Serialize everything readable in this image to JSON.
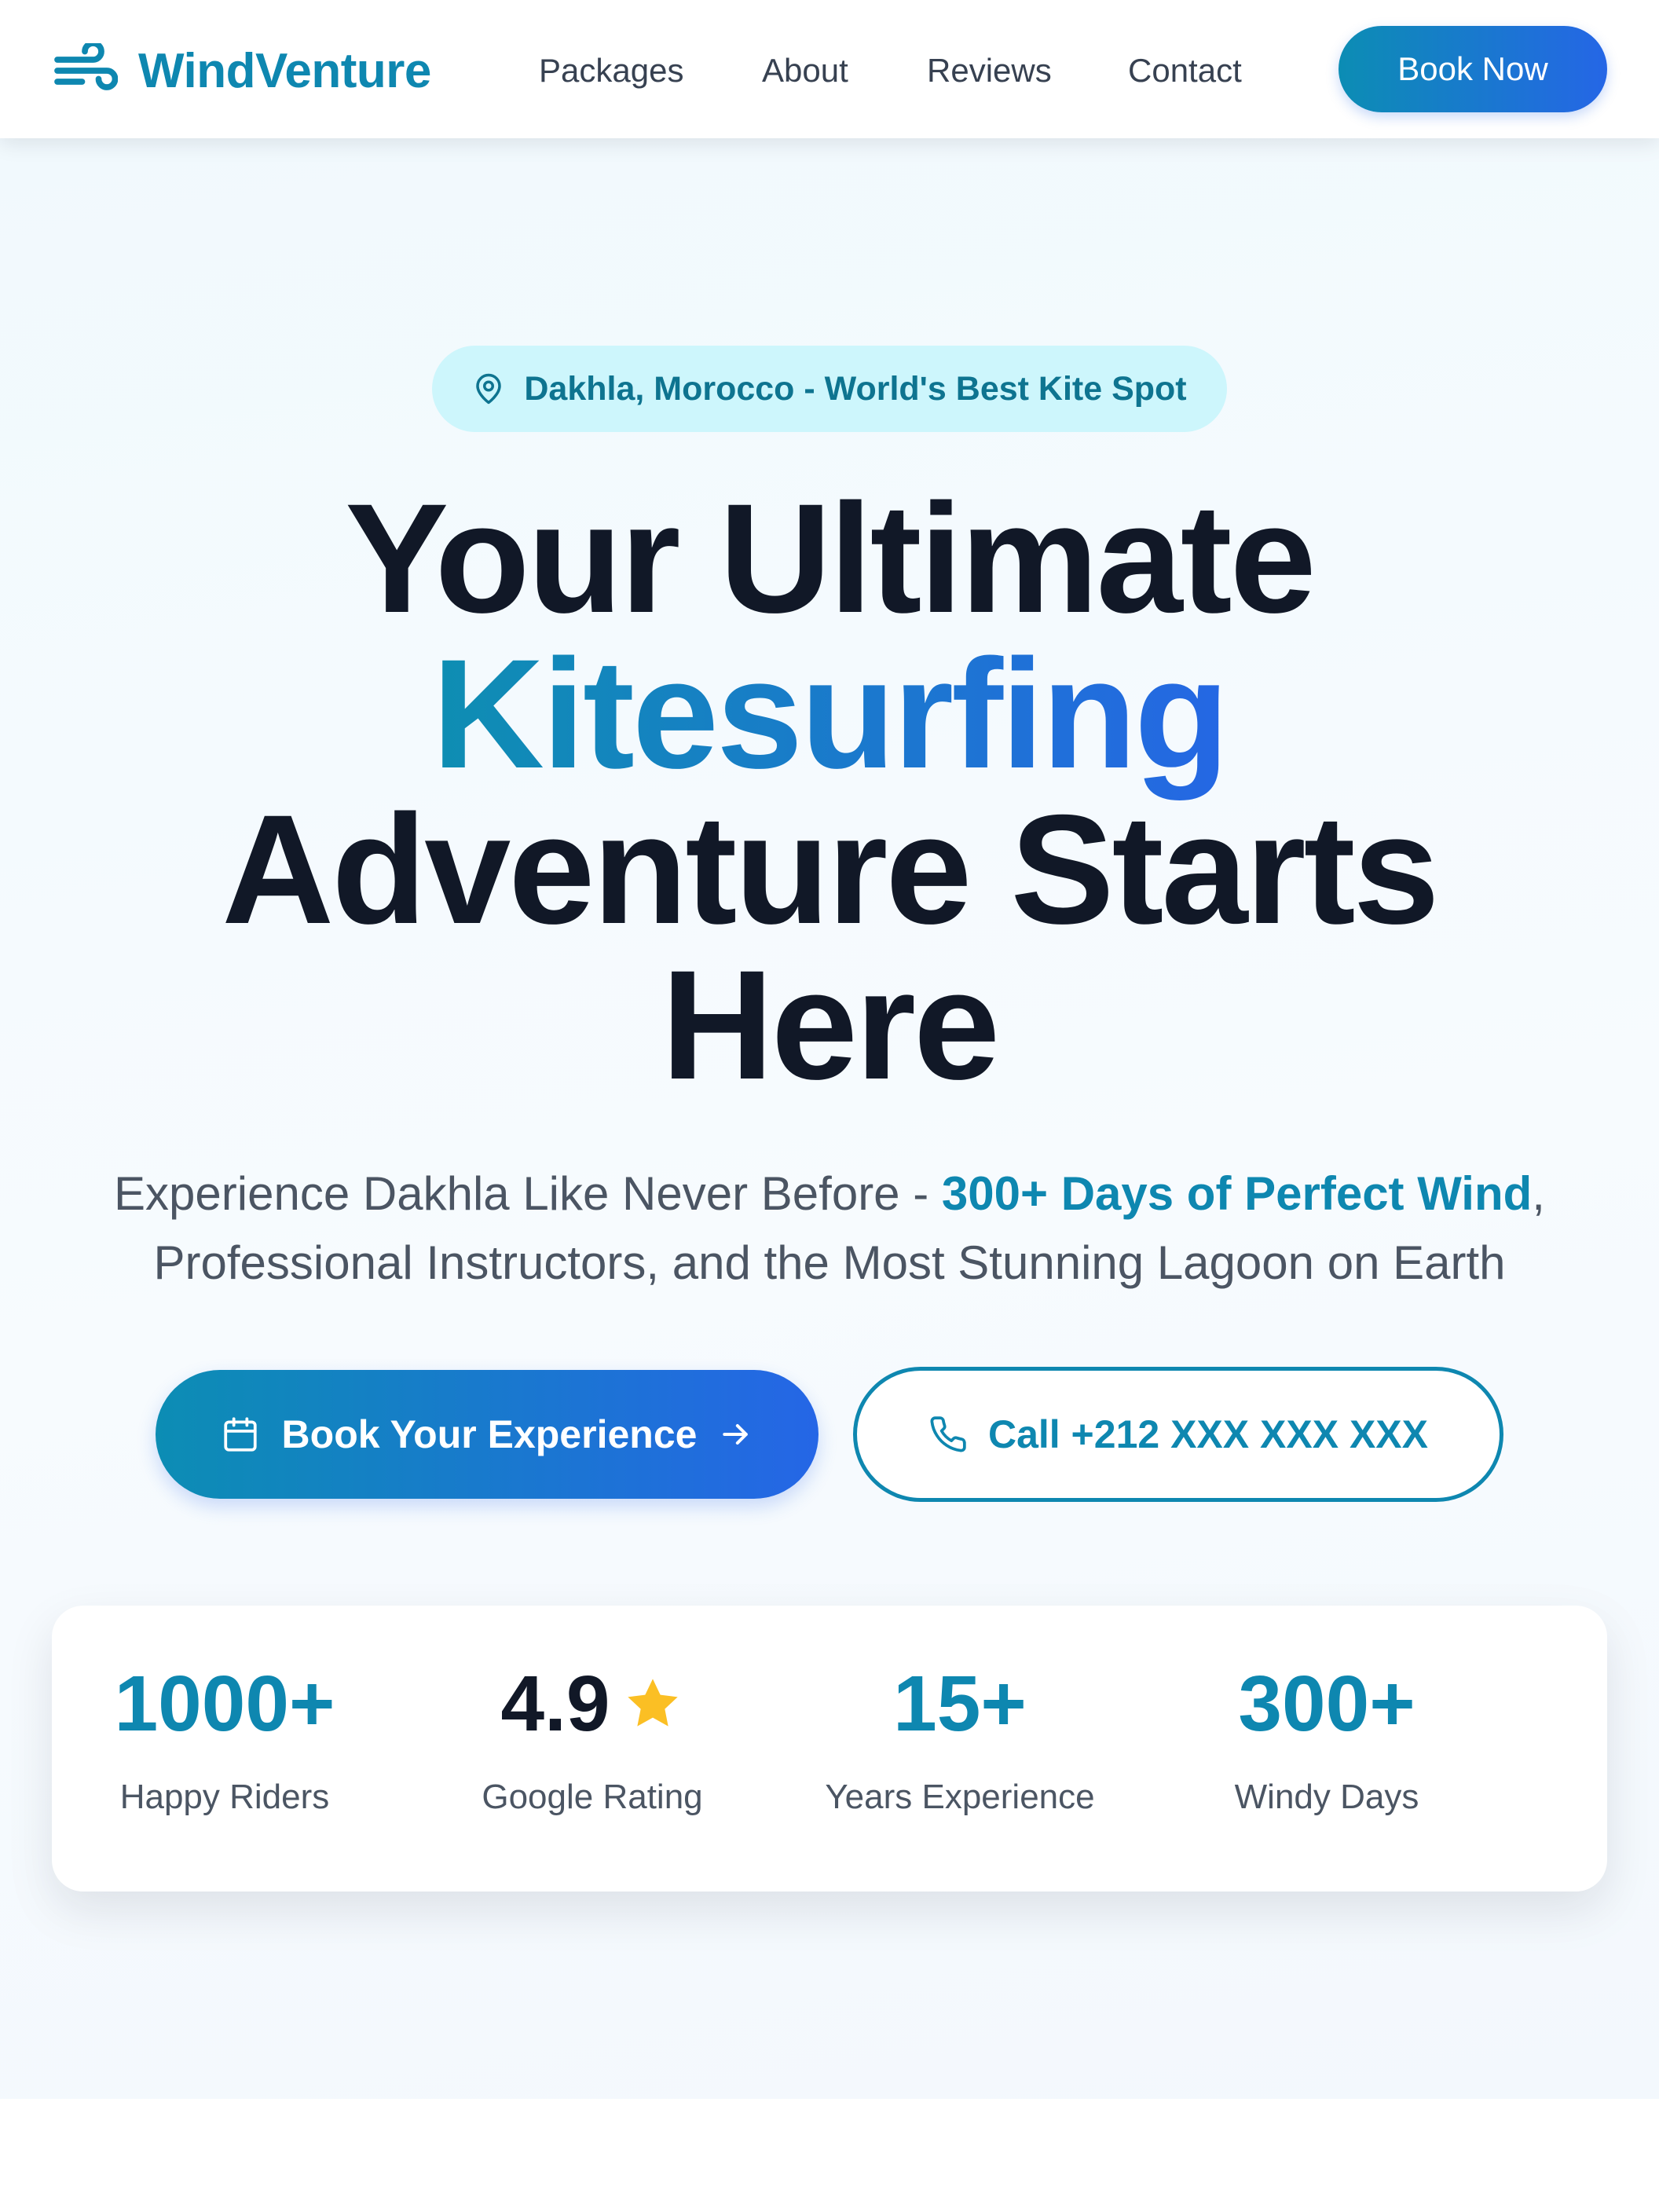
{
  "brand": {
    "name": "WindVenture",
    "icon": "wind-icon"
  },
  "nav": {
    "links": [
      "Packages",
      "About",
      "Reviews",
      "Contact"
    ],
    "cta": "Book Now"
  },
  "hero": {
    "badge": {
      "icon": "map-pin-icon",
      "text": "Dakhla, Morocco - World's Best Kite Spot"
    },
    "headline": {
      "line1": "Your Ultimate",
      "highlight": "Kitesurfing",
      "line3": "Adventure Starts",
      "line4": "Here"
    },
    "subtitle": {
      "before": "Experience Dakhla Like Never Before - ",
      "highlight": "300+ Days of Perfect Wind",
      "after": ", Professional Instructors, and the Most Stunning Lagoon on Earth"
    },
    "primary_cta": {
      "icon": "calendar-icon",
      "label": "Book Your Experience",
      "trailing_icon": "arrow-right-icon"
    },
    "secondary_cta": {
      "icon": "phone-icon",
      "label": "Call +212 XXX XXX XXX"
    }
  },
  "stats": [
    {
      "value": "1000+",
      "label": "Happy Riders"
    },
    {
      "value": "4.9",
      "label": "Google Rating",
      "icon": "star-icon"
    },
    {
      "value": "15+",
      "label": "Years Experience"
    },
    {
      "value": "300+",
      "label": "Windy Days"
    }
  ],
  "colors": {
    "accent": "#0e87b0",
    "gradient_start": "#0c8db4",
    "gradient_end": "#2566e6",
    "badge_bg": "#cdf6fc",
    "heading": "#111827",
    "body_text": "#4b5563",
    "star": "#fbbf24"
  }
}
